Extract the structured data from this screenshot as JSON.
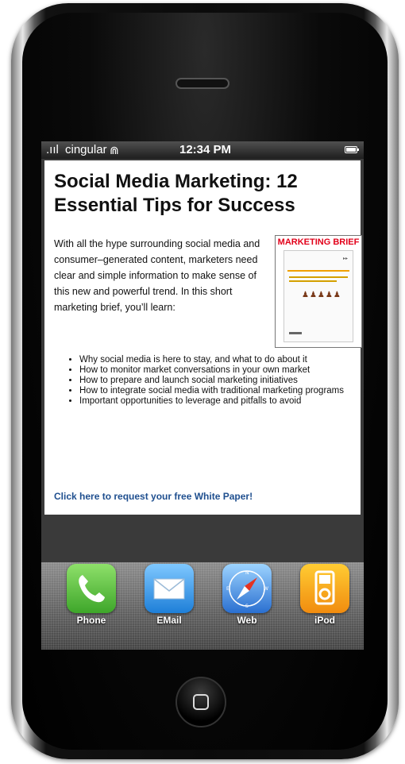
{
  "status_bar": {
    "signal": ".ııl",
    "carrier": "cingular",
    "wifi": "⋒",
    "time": "12:34 PM"
  },
  "article": {
    "title": "Social Media Marketing: 12 Essential Tips for Success",
    "intro": "With all the hype surrounding social media and consumer–generated content, marketers need clear and simple information to make sense of this new and powerful trend. In this short marketing brief, you’ll learn:",
    "brief_label": "MARKETING BRIEF",
    "bullets": [
      "Why social media is here to stay, and what to do about it",
      "How to monitor market conversations in your own market",
      "How to prepare and launch social marketing initiatives",
      "How to integrate social media with traditional marketing programs",
      "Important opportunities to leverage and pitfalls to avoid"
    ],
    "cta": "Click here to request your free White Paper!"
  },
  "dock": {
    "apps": [
      {
        "label": "Phone",
        "icon": "phone-icon",
        "color": "#4cb830"
      },
      {
        "label": "EMail",
        "icon": "mail-icon",
        "color": "#2a88de"
      },
      {
        "label": "Web",
        "icon": "compass-icon",
        "color": "#3a7fd8"
      },
      {
        "label": "iPod",
        "icon": "ipod-icon",
        "color": "#f59a16"
      }
    ]
  }
}
